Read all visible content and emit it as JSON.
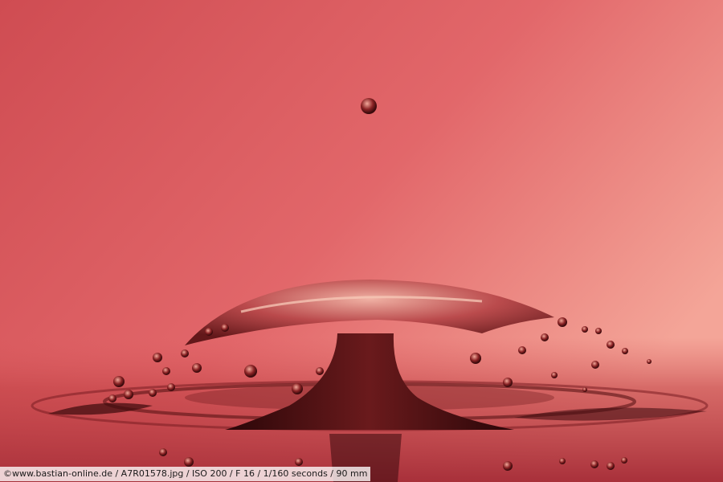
{
  "photo": {
    "subject": "water-drop-splash",
    "colors": {
      "background_top": "#d8565a",
      "background_mid": "#e8736d",
      "background_light": "#f3a296",
      "surface": "#b83a3c",
      "splash_dark": "#3a0a0c",
      "splash_mid": "#8a2a2c",
      "highlight": "#f7c9b8"
    }
  },
  "caption": {
    "text": "©www.bastian-online.de / A7R01578.jpg / ISO 200 / F 16 / 1/160 seconds  / 90 mm"
  }
}
